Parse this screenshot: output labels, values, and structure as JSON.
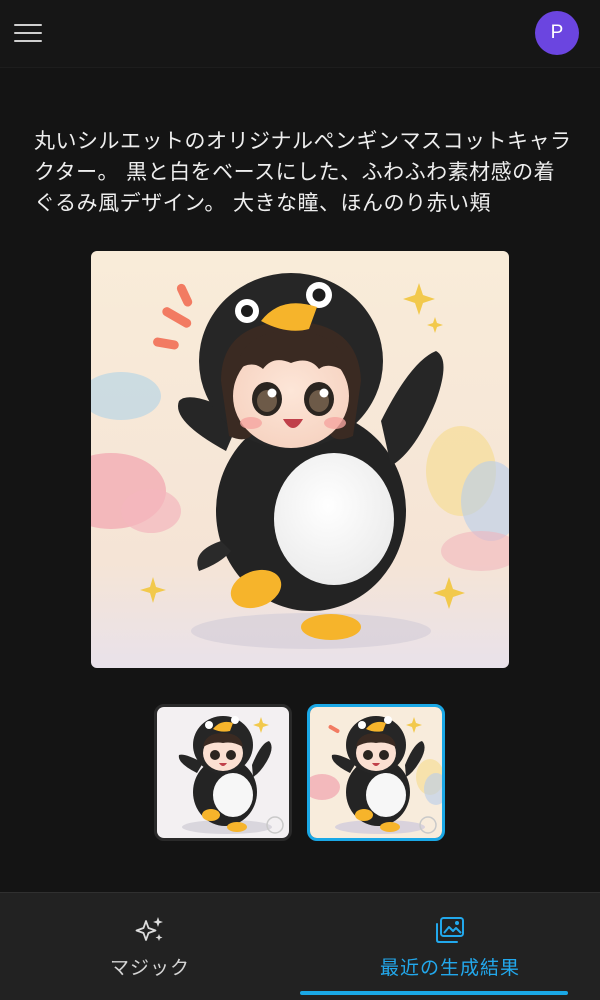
{
  "header": {
    "menu_icon": "hamburger-menu-icon",
    "avatar_initial": "P"
  },
  "prompt": {
    "text": "丸いシルエットのオリジナルペンギンマスコットキャラクター。 黒と白をベースにした、ふわふわ素材感の着ぐるみ風デザイン。 大きな瞳、ほんのり赤い頬"
  },
  "result": {
    "download_icon": "download-icon",
    "thumbnails_count": 2,
    "selected_thumbnail": 2
  },
  "nav": {
    "magic_label": "マジック",
    "magic_icon": "sparkles-icon",
    "recent_label": "最近の生成結果",
    "recent_icon": "gallery-icon",
    "active": "recent"
  },
  "colors": {
    "accent": "#1aa8e6",
    "avatar": "#6b45e0",
    "background": "#141414"
  }
}
